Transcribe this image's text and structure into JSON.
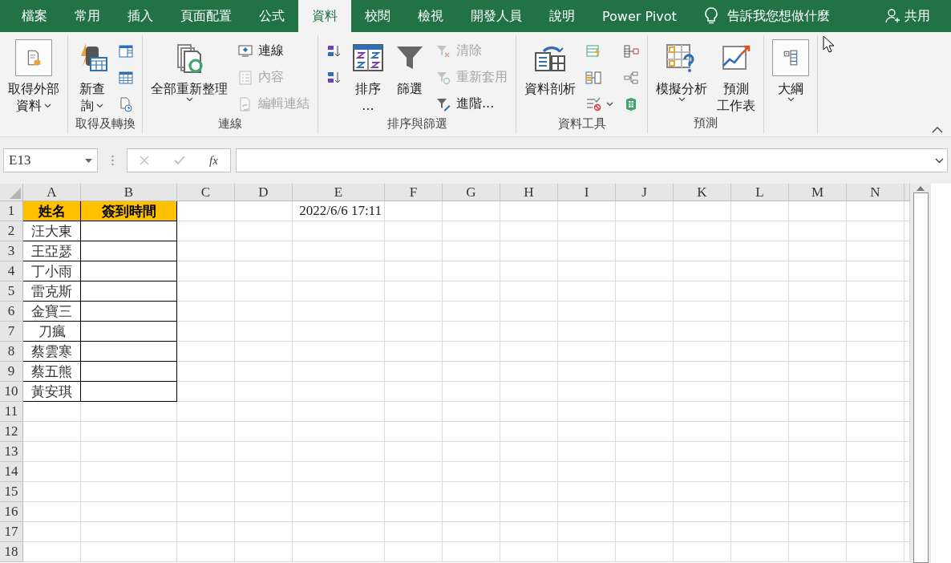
{
  "tabs": [
    {
      "label": "檔案",
      "selected": false
    },
    {
      "label": "常用",
      "selected": false
    },
    {
      "label": "插入",
      "selected": false
    },
    {
      "label": "頁面配置",
      "selected": false
    },
    {
      "label": "公式",
      "selected": false
    },
    {
      "label": "資料",
      "selected": true
    },
    {
      "label": "校閱",
      "selected": false
    },
    {
      "label": "檢視",
      "selected": false
    },
    {
      "label": "開發人員",
      "selected": false
    },
    {
      "label": "說明",
      "selected": false
    },
    {
      "label": "Power Pivot",
      "selected": false
    }
  ],
  "tell_me": "告訴我您想做什麼",
  "share": "共用",
  "ribbon": [
    {
      "items": [
        {
          "kind": "collapsed",
          "lines": [
            "取得外部",
            "資料"
          ],
          "dropdown": true
        }
      ]
    },
    {
      "label": "取得及轉換",
      "items": [
        {
          "kind": "large",
          "lines": [
            "新查",
            "詢"
          ],
          "dropdown": true
        },
        {
          "kind": "stack",
          "items": [
            {
              "disabled": false,
              "dropdown": false
            },
            {
              "disabled": false,
              "dropdown": false
            },
            {
              "disabled": false,
              "dropdown": false
            }
          ]
        }
      ]
    },
    {
      "label": "連線",
      "items": [
        {
          "kind": "large",
          "lines": [
            "全部重新整理"
          ],
          "dropdown": true
        },
        {
          "kind": "stack",
          "items": [
            {
              "label": "連線",
              "disabled": false,
              "dropdown": false
            },
            {
              "label": "內容",
              "disabled": true,
              "dropdown": false
            },
            {
              "label": "編輯連結",
              "disabled": true,
              "dropdown": false
            }
          ]
        }
      ]
    },
    {
      "label": "排序與篩選",
      "items": [
        {
          "kind": "stack",
          "items": [
            {
              "disabled": false,
              "dropdown": false
            },
            {
              "disabled": false,
              "dropdown": false
            }
          ]
        },
        {
          "kind": "large",
          "lines": [
            "排序",
            "..."
          ],
          "dropdown": false
        },
        {
          "kind": "large",
          "lines": [
            "篩選"
          ],
          "dropdown": false
        },
        {
          "kind": "stack",
          "items": [
            {
              "label": "清除",
              "disabled": true,
              "dropdown": false
            },
            {
              "label": "重新套用",
              "disabled": true,
              "dropdown": false
            },
            {
              "label": "進階...",
              "disabled": false,
              "dropdown": false
            }
          ]
        }
      ]
    },
    {
      "label": "資料工具",
      "items": [
        {
          "kind": "large",
          "lines": [
            "資料剖析"
          ],
          "dropdown": false
        },
        {
          "kind": "stack",
          "items": [
            {
              "disabled": false,
              "dropdown": false
            },
            {
              "disabled": false,
              "dropdown": false
            },
            {
              "disabled": false,
              "dropdown": true
            }
          ]
        },
        {
          "kind": "stack",
          "items": [
            {
              "disabled": false,
              "dropdown": false
            },
            {
              "disabled": false,
              "dropdown": false
            },
            {
              "disabled": false,
              "dropdown": false
            }
          ]
        }
      ]
    },
    {
      "label": "預測",
      "items": [
        {
          "kind": "large",
          "lines": [
            "模擬分析"
          ],
          "dropdown": true
        },
        {
          "kind": "large",
          "lines": [
            "預測",
            "工作表"
          ],
          "dropdown": false
        }
      ]
    },
    {
      "items": [
        {
          "kind": "collapsed",
          "lines": [
            "大綱"
          ],
          "dropdown": true
        }
      ]
    }
  ],
  "formula_bar": {
    "name_box": "E13",
    "fx": "fx"
  },
  "sheet": {
    "columns": [
      {
        "label": "A"
      },
      {
        "label": "B"
      },
      {
        "label": "C"
      },
      {
        "label": "D"
      },
      {
        "label": "E",
        "values": [
          "2022/6/6 17:11"
        ]
      },
      {
        "label": "F"
      },
      {
        "label": "G"
      },
      {
        "label": "H"
      },
      {
        "label": "I"
      },
      {
        "label": "J"
      },
      {
        "label": "K"
      },
      {
        "label": "L"
      },
      {
        "label": "M"
      },
      {
        "label": "N"
      }
    ],
    "row_numbers": [
      "1",
      "2",
      "3",
      "4",
      "5",
      "6",
      "7",
      "8",
      "9",
      "10",
      "11",
      "12",
      "13",
      "14",
      "15",
      "16",
      "17",
      "18"
    ],
    "table": {
      "header": [
        "姓名",
        "簽到時間"
      ],
      "rows": [
        [
          "汪大東"
        ],
        [
          "王亞瑟"
        ],
        [
          "丁小雨"
        ],
        [
          "雷克斯"
        ],
        [
          "金寶三"
        ],
        [
          "刀瘋"
        ],
        [
          "蔡雲寒"
        ],
        [
          "蔡五熊"
        ],
        [
          "黃安琪"
        ]
      ]
    }
  }
}
